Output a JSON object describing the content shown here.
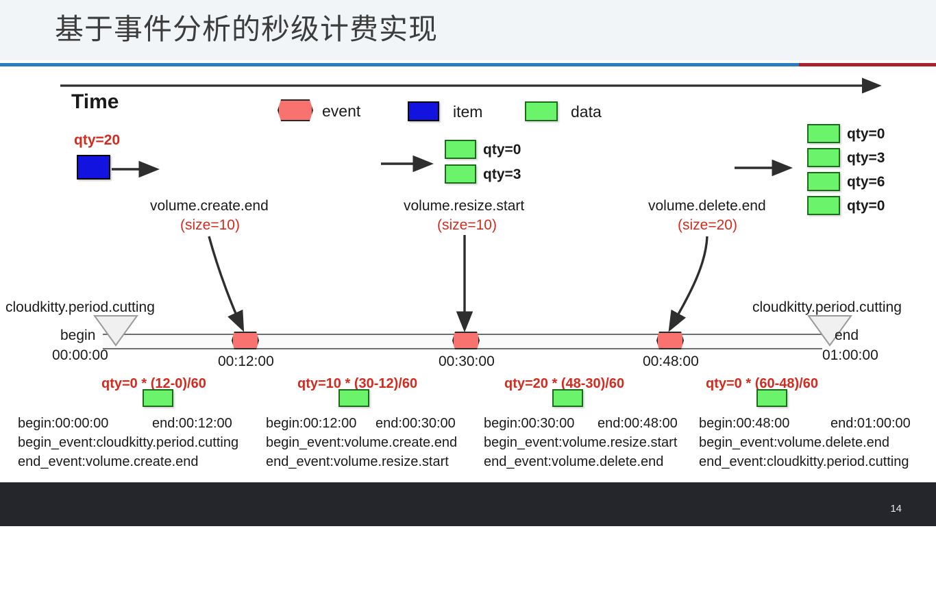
{
  "header": {
    "title": "基于事件分析的秒级计费实现",
    "rule_blue": "#2b7cc0",
    "rule_red": "#a8222b"
  },
  "footer": {
    "page_number": "14"
  },
  "diagram": {
    "time_axis_label": "Time",
    "legend": [
      {
        "label": "event",
        "shape": "hexagon",
        "color": "#f8736f"
      },
      {
        "label": "item",
        "shape": "rect",
        "color": "#1313e0"
      },
      {
        "label": "data",
        "shape": "rect",
        "color": "#6cf36c"
      }
    ],
    "item_stage": {
      "qty_label": "qty=20"
    },
    "middle_stage": {
      "qty_labels": [
        "qty=0",
        "qty=3"
      ]
    },
    "right_stage": {
      "qty_labels": [
        "qty=0",
        "qty=3",
        "qty=6",
        "qty=0"
      ]
    },
    "events": [
      {
        "name": "volume.create.end",
        "size": "(size=10)"
      },
      {
        "name": "volume.resize.start",
        "size": "(size=10)"
      },
      {
        "name": "volume.delete.end",
        "size": "(size=20)"
      }
    ],
    "timeline": {
      "left_cut_label": "cloudkitty.period.cutting",
      "right_cut_label": "cloudkitty.period.cutting",
      "begin_label": "begin",
      "end_label": "end",
      "begin_time": "00:00:00",
      "end_time": "01:00:00",
      "tick_times": [
        "00:12:00",
        "00:30:00",
        "00:48:00"
      ]
    },
    "qty_formulas": [
      "qty=0 * (12-0)/60",
      "qty=10 * (30-12)/60",
      "qty=20 * (48-30)/60",
      "qty=0 * (60-48)/60"
    ],
    "periods": [
      {
        "begin": "begin:00:00:00",
        "end": "end:00:12:00",
        "begin_event": "begin_event:cloudkitty.period.cutting",
        "end_event": "end_event:volume.create.end"
      },
      {
        "begin": "begin:00:12:00",
        "end": "end:00:30:00",
        "begin_event": "begin_event:volume.create.end",
        "end_event": "end_event:volume.resize.start"
      },
      {
        "begin": "begin:00:30:00",
        "end": "end:00:48:00",
        "begin_event": "begin_event:volume.resize.start",
        "end_event": "end_event:volume.delete.end"
      },
      {
        "begin": "begin:00:48:00",
        "end": "end:01:00:00",
        "begin_event": "begin_event:volume.delete.end",
        "end_event": "end_event:cloudkitty.period.cutting"
      }
    ]
  }
}
